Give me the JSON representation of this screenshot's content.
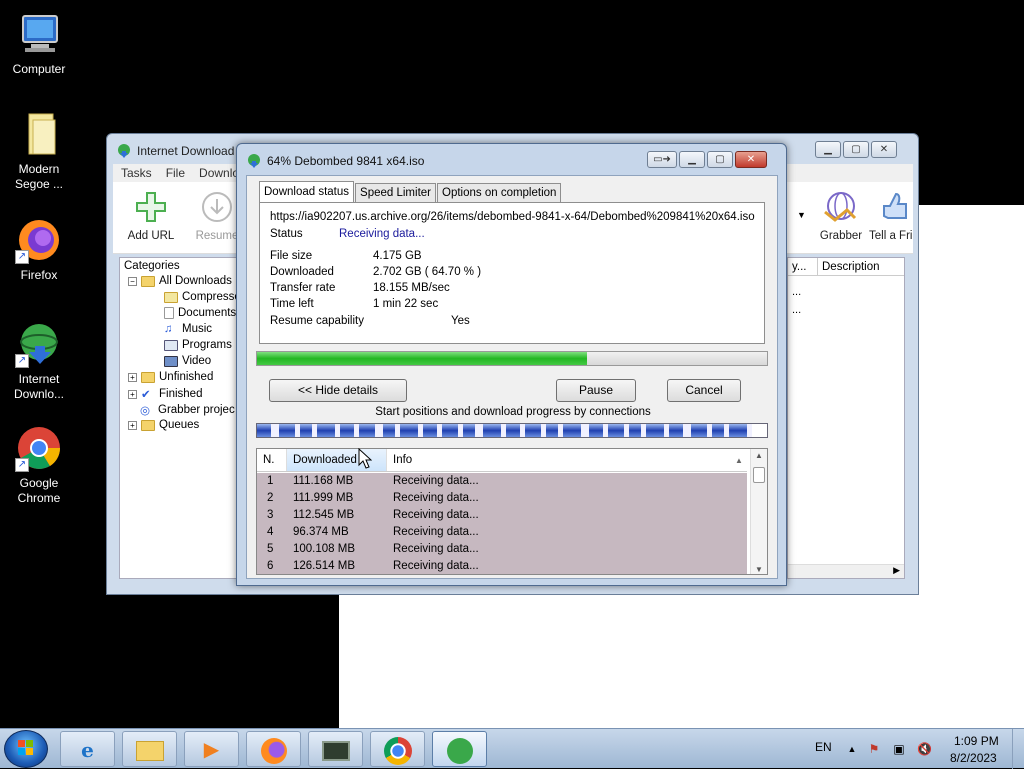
{
  "desktop": {
    "icons": [
      {
        "label": "Computer",
        "icon": "computer-icon"
      },
      {
        "label": "Modern Segoe ...",
        "icon": "folder-icon"
      },
      {
        "label": "Firefox",
        "icon": "firefox-icon"
      },
      {
        "label": "Internet Downlo...",
        "icon": "idm-icon"
      },
      {
        "label": "Google Chrome",
        "icon": "chrome-icon"
      }
    ]
  },
  "main_window": {
    "title": "Internet Download",
    "menu": [
      "Tasks",
      "File",
      "Downlo"
    ],
    "toolbar": [
      {
        "label": "Add URL",
        "icon": "plus-icon"
      },
      {
        "label": "Resume",
        "icon": "resume-icon"
      },
      {
        "label": "Grabber",
        "icon": "grabber-icon"
      },
      {
        "label": "Tell a Fri",
        "icon": "thumbs-up-icon"
      }
    ],
    "categories_title": "Categories",
    "tree": [
      {
        "label": "All Downloads"
      },
      {
        "label": "Compresse"
      },
      {
        "label": "Documents"
      },
      {
        "label": "Music"
      },
      {
        "label": "Programs"
      },
      {
        "label": "Video"
      },
      {
        "label": "Unfinished"
      },
      {
        "label": "Finished"
      },
      {
        "label": "Grabber projec"
      },
      {
        "label": "Queues"
      }
    ],
    "list_columns": [
      "y...",
      "Description"
    ],
    "list_cells": [
      "...",
      "..."
    ]
  },
  "dialog": {
    "title": "64% Debombed 9841 x64.iso",
    "tabs": [
      "Download status",
      "Speed Limiter",
      "Options on completion"
    ],
    "url": "https://ia902207.us.archive.org/26/items/debombed-9841-x-64/Debombed%209841%20x64.iso",
    "status_label": "Status",
    "status_value": "Receiving data...",
    "file_size_label": "File size",
    "file_size_value": "4.175  GB",
    "downloaded_label": "Downloaded",
    "downloaded_value": "2.702  GB  ( 64.70 % )",
    "transfer_rate_label": "Transfer rate",
    "transfer_rate_value": "18.155  MB/sec",
    "time_left_label": "Time left",
    "time_left_value": "1 min 22 sec",
    "resume_label": "Resume capability",
    "resume_value": "Yes",
    "progress_percent": 64.7,
    "hide_details_button": "<< Hide details",
    "pause_button": "Pause",
    "cancel_button": "Cancel",
    "connections_caption": "Start positions and download progress by connections",
    "connections_table": {
      "columns": [
        "N.",
        "Downloaded",
        "Info"
      ],
      "rows": [
        {
          "n": "1",
          "downloaded": "111.168  MB",
          "info": "Receiving data..."
        },
        {
          "n": "2",
          "downloaded": "111.999  MB",
          "info": "Receiving data..."
        },
        {
          "n": "3",
          "downloaded": "112.545  MB",
          "info": "Receiving data..."
        },
        {
          "n": "4",
          "downloaded": "96.374  MB",
          "info": "Receiving data..."
        },
        {
          "n": "5",
          "downloaded": "100.108  MB",
          "info": "Receiving data..."
        },
        {
          "n": "6",
          "downloaded": "126.514  MB",
          "info": "Receiving data..."
        }
      ]
    }
  },
  "taskbar": {
    "apps": [
      "ie-icon",
      "explorer-icon",
      "media-icon",
      "firefox-icon",
      "terminal-icon",
      "chrome-icon",
      "idm-icon"
    ],
    "language": "EN",
    "time": "1:09 PM",
    "date": "8/2/2023"
  },
  "colors": {
    "progress": "#23b723",
    "status_text": "#1a1a9c",
    "connection_segment": "#2040b0"
  }
}
